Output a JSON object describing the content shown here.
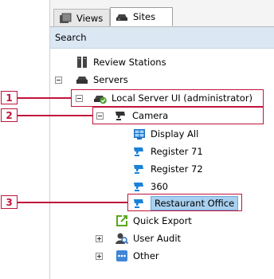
{
  "tabs": [
    {
      "label": "Views",
      "icon": "views-icon"
    },
    {
      "label": "Sites",
      "icon": "sites-icon"
    }
  ],
  "search": {
    "label": "Search"
  },
  "tree": {
    "review_stations": "Review Stations",
    "servers": "Servers",
    "local_server": "Local Server UI (administrator)",
    "camera": "Camera",
    "display_all": "Display All",
    "register_71": "Register 71",
    "register_72": "Register 72",
    "cam_360": "360",
    "restaurant_office": "Restaurant Office",
    "quick_export": "Quick Export",
    "user_audit": "User Audit",
    "other": "Other"
  },
  "callouts": [
    "1",
    "2",
    "3"
  ],
  "colors": {
    "callout": "#c0143c",
    "selection": "#a8d0f0",
    "search_bar": "#dbe7f3"
  }
}
